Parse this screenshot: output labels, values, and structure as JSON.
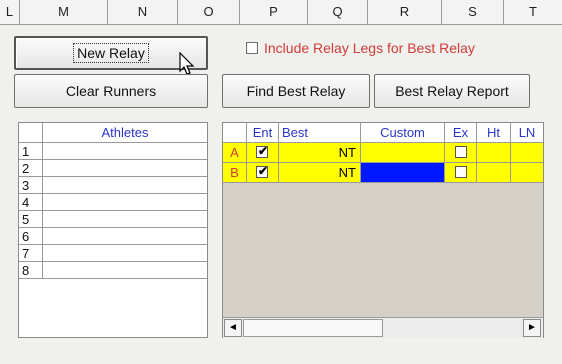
{
  "column_headers": [
    "L",
    "M",
    "N",
    "O",
    "P",
    "Q",
    "R",
    "S",
    "T"
  ],
  "buttons": {
    "new_relay": "New Relay",
    "clear_runners": "Clear Runners",
    "find_best_relay": "Find Best Relay",
    "best_relay_report": "Best Relay Report"
  },
  "include_legs": {
    "label": "Include Relay Legs for Best Relay",
    "checked": false
  },
  "athletes_grid": {
    "header": "Athletes",
    "rows": [
      "1",
      "2",
      "3",
      "4",
      "5",
      "6",
      "7",
      "8"
    ]
  },
  "relay_grid": {
    "headers": [
      "Ent",
      "Best",
      "Custom",
      "Ex",
      "Ht",
      "LN"
    ],
    "rows": [
      {
        "team": "A",
        "entered": true,
        "best": "NT",
        "custom": "",
        "ex": false
      },
      {
        "team": "B",
        "entered": true,
        "best": "NT",
        "custom": "",
        "ex": false
      }
    ]
  },
  "colors": {
    "label_red": "#d23c3c",
    "header_blue": "#2a35c8",
    "row_yellow": "#ffff00",
    "selected_blue": "#0018ff",
    "empty_tan": "#d5d0c7"
  },
  "icons": {
    "scroll_left": "◄",
    "scroll_right": "►",
    "check": "✔"
  }
}
